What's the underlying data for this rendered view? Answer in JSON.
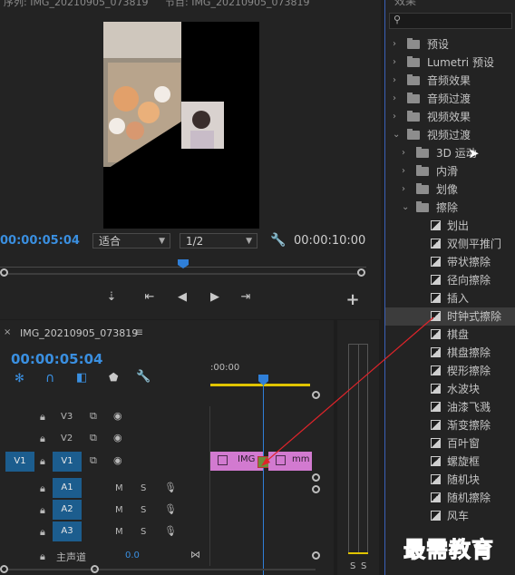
{
  "monitor": {
    "tab_partial_1": "序列: IMG_20210905_073819",
    "tab_partial_2": "节目: IMG_20210905_073819",
    "current_time": "00:00:05:04",
    "zoom": "适合",
    "resolution": "1/2",
    "duration": "00:00:10:00"
  },
  "timeline": {
    "sequence_name": "IMG_20210905_073819",
    "current_time": "00:00:05:04",
    "ruler_label": ":00:00",
    "tracks": {
      "v3": "V3",
      "v2": "V2",
      "v1_src": "V1",
      "v1": "V1",
      "a1": "A1",
      "a2": "A2",
      "a3": "A3"
    },
    "mute_label": "M",
    "solo_label": "S",
    "master_label": "主声道",
    "master_value": "0.0",
    "clip1_label": "IMG",
    "clip2_label": "mm"
  },
  "meter": {
    "s1": "S",
    "s2": "S"
  },
  "effects": {
    "header": "效果",
    "items": [
      {
        "label": "预设",
        "level": 0,
        "kind": "folder-star",
        "state": "collapsed"
      },
      {
        "label": "Lumetri 预设",
        "level": 0,
        "kind": "folder-star",
        "state": "collapsed"
      },
      {
        "label": "音频效果",
        "level": 0,
        "kind": "folder",
        "state": "collapsed"
      },
      {
        "label": "音频过渡",
        "level": 0,
        "kind": "folder",
        "state": "collapsed"
      },
      {
        "label": "视频效果",
        "level": 0,
        "kind": "folder",
        "state": "collapsed"
      },
      {
        "label": "视频过渡",
        "level": 0,
        "kind": "folder",
        "state": "expanded"
      },
      {
        "label": "3D 运动",
        "level": 1,
        "kind": "folder",
        "state": "collapsed"
      },
      {
        "label": "内滑",
        "level": 1,
        "kind": "folder",
        "state": "collapsed"
      },
      {
        "label": "划像",
        "level": 1,
        "kind": "folder",
        "state": "collapsed"
      },
      {
        "label": "擦除",
        "level": 1,
        "kind": "folder",
        "state": "expanded"
      },
      {
        "label": "划出",
        "level": 2,
        "kind": "effect"
      },
      {
        "label": "双侧平推门",
        "level": 2,
        "kind": "effect"
      },
      {
        "label": "带状擦除",
        "level": 2,
        "kind": "effect"
      },
      {
        "label": "径向擦除",
        "level": 2,
        "kind": "effect"
      },
      {
        "label": "插入",
        "level": 2,
        "kind": "effect"
      },
      {
        "label": "时钟式擦除",
        "level": 2,
        "kind": "effect",
        "selected": true
      },
      {
        "label": "棋盘",
        "level": 2,
        "kind": "effect"
      },
      {
        "label": "棋盘擦除",
        "level": 2,
        "kind": "effect"
      },
      {
        "label": "楔形擦除",
        "level": 2,
        "kind": "effect"
      },
      {
        "label": "水波块",
        "level": 2,
        "kind": "effect"
      },
      {
        "label": "油漆飞溅",
        "level": 2,
        "kind": "effect"
      },
      {
        "label": "渐变擦除",
        "level": 2,
        "kind": "effect"
      },
      {
        "label": "百叶窗",
        "level": 2,
        "kind": "effect"
      },
      {
        "label": "螺旋框",
        "level": 2,
        "kind": "effect"
      },
      {
        "label": "随机块",
        "level": 2,
        "kind": "effect"
      },
      {
        "label": "随机擦除",
        "level": 2,
        "kind": "effect"
      },
      {
        "label": "风车",
        "level": 2,
        "kind": "effect"
      }
    ]
  },
  "watermark": "最需教育",
  "colors": {
    "accent": "#3a8fe0",
    "clip": "#d27ad0",
    "arrow": "#e0242a"
  }
}
